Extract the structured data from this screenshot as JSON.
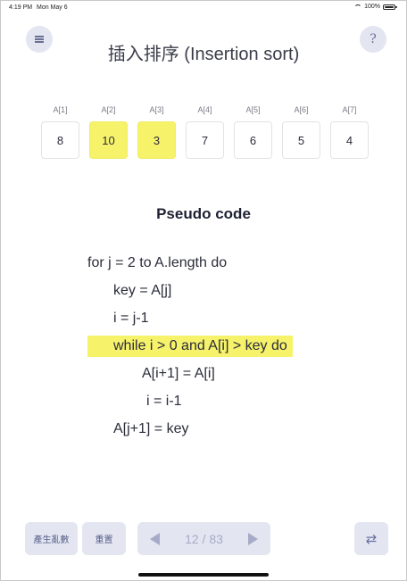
{
  "status_bar": {
    "time": "4:19 PM",
    "date": "Mon May 6",
    "battery": "100%",
    "battery_level": 1.0
  },
  "header": {
    "menu_icon": "hamburger-menu-icon",
    "help_label": "?",
    "title": "插入排序 (Insertion sort)"
  },
  "array": {
    "cells": [
      {
        "label": "A[1]",
        "value": "8",
        "highlighted": false
      },
      {
        "label": "A[2]",
        "value": "10",
        "highlighted": true
      },
      {
        "label": "A[3]",
        "value": "3",
        "highlighted": true
      },
      {
        "label": "A[4]",
        "value": "7",
        "highlighted": false
      },
      {
        "label": "A[5]",
        "value": "6",
        "highlighted": false
      },
      {
        "label": "A[6]",
        "value": "5",
        "highlighted": false
      },
      {
        "label": "A[7]",
        "value": "4",
        "highlighted": false
      }
    ],
    "highlight_color": "#f6f26a"
  },
  "pseudo_code": {
    "heading": "Pseudo code",
    "lines": [
      "for j = 2 to A.length do",
      "key = A[j]",
      "i = j-1",
      "while i > 0 and A[i] > key do",
      "A[i+1] = A[i]",
      "i = i-1",
      "A[j+1] = key"
    ],
    "highlighted_line": 3
  },
  "controls": {
    "generate_label": "產生亂數",
    "reset_label": "重置",
    "prev_icon": "triangle-left-icon",
    "next_icon": "triangle-right-icon",
    "step_counter": "12 / 83",
    "swap_icon": "swap-arrows-icon",
    "swap_glyph": "⇄"
  }
}
